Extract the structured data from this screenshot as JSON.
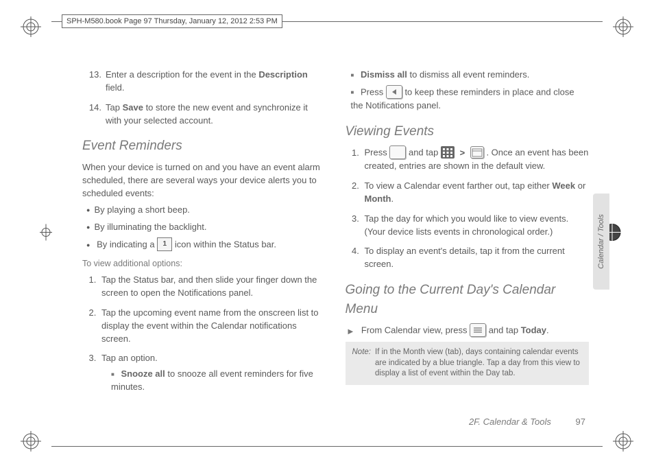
{
  "header": "SPH-M580.book  Page 97  Thursday, January 12, 2012  2:53 PM",
  "side_tab": "Calendar / Tools",
  "footer_section": "2F. Calendar & Tools",
  "page_number": "97",
  "left": {
    "step13_num": "13.",
    "step13_a": "Enter a description for the event in the ",
    "step13_b": "Description",
    "step13_c": " field.",
    "step14_num": "14.",
    "step14_a": "Tap ",
    "step14_b": "Save",
    "step14_c": " to store the new event and synchronize it with your selected account.",
    "h_event_reminders": "Event Reminders",
    "p_intro": "When your device is turned on and you have an event alarm scheduled, there are several ways your device alerts you to scheduled events:",
    "d1": "By playing a short beep.",
    "d2": "By illuminating the backlight.",
    "d3_a": "By indicating a ",
    "d3_b": " icon within the Status bar.",
    "icon_one": "1",
    "tvo": "To view additional options:",
    "o1": "Tap the Status bar, and then slide your finger down the screen to open the Notifications panel.",
    "o2": "Tap the upcoming event name from the onscreen list to display the event within the Calendar notifications screen.",
    "o3": "Tap an option.",
    "sq1_a": "Snooze all",
    "sq1_b": " to snooze all event reminders for five minutes."
  },
  "right": {
    "sq2_a": "Dismiss all",
    "sq2_b": " to dismiss all event reminders.",
    "sq3_a": "Press ",
    "sq3_b": " to keep these reminders in place and close the Notifications panel.",
    "h_viewing": "Viewing Events",
    "v1_a": "Press ",
    "v1_b": " and tap ",
    "v1_c": ". Once an event has been created, entries are shown in the default view.",
    "gt": ">",
    "v2_a": "To view a Calendar event farther out, tap either ",
    "v2_b": "Week",
    "v2_or": " or ",
    "v2_c": "Month",
    "v2_d": ".",
    "v3": "Tap the day for which you would like to view events. (Your device lists events in chronological order.)",
    "v4": "To display an event's details, tap it from the current screen.",
    "h_going": "Going to the Current Day's Calendar Menu",
    "g1_a": "From Calendar view, press ",
    "g1_b": " and tap ",
    "g1_c": "Today",
    "g1_d": ".",
    "note_label": "Note:",
    "note_body": "If in the Month view (tab), days containing calendar events are indicated by a blue triangle. Tap a day from this view to display a list of event within the Day tab."
  }
}
